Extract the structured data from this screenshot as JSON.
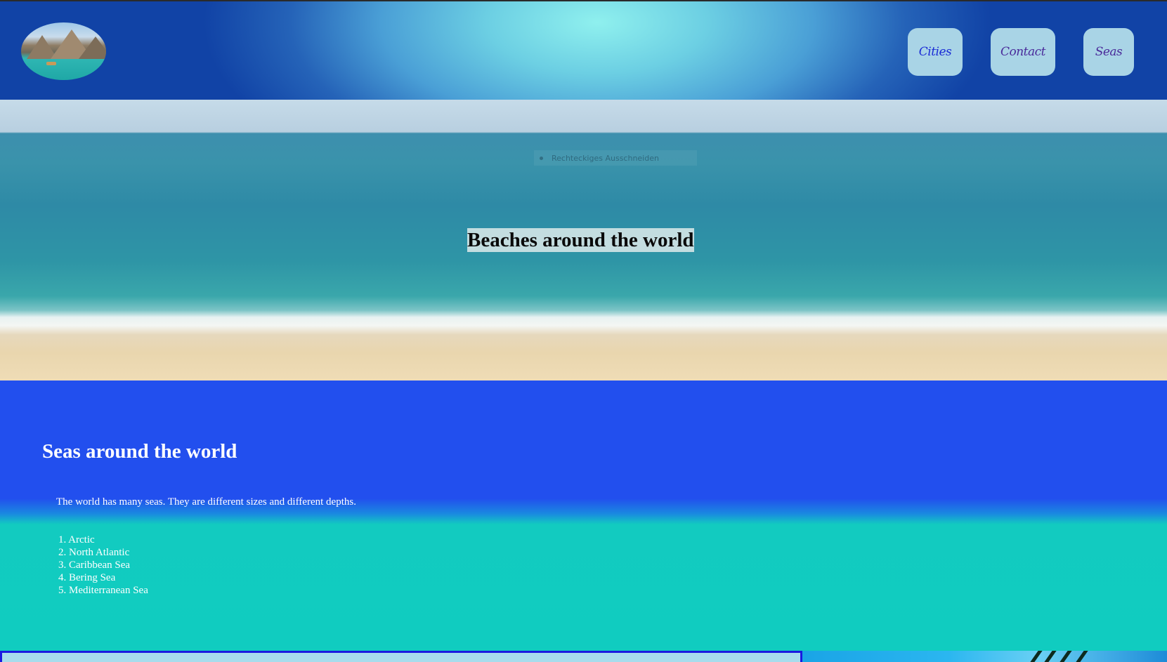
{
  "header": {
    "nav": [
      {
        "label": "Cities"
      },
      {
        "label": "Contact"
      },
      {
        "label": "Seas"
      }
    ]
  },
  "hero": {
    "title": "Beaches around the world",
    "hint": "Rechteckiges Ausschneiden"
  },
  "seas": {
    "heading": "Seas around the world",
    "intro": "The world has many seas. They are different sizes and different depths.",
    "items": [
      "1. Arctic",
      "2. North Atlantic",
      "3. Caribbean Sea",
      "4. Bering Sea",
      "5. Mediterranean Sea"
    ]
  },
  "colors": {
    "header_center": "#8ff0ee",
    "header_edge": "#1143a6",
    "nav_button": "#a9d4e6",
    "seas_blue": "#224fee",
    "seas_teal": "#10ccc0"
  }
}
